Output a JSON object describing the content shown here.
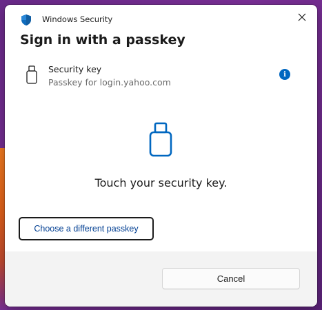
{
  "window": {
    "app_title": "Windows Security",
    "heading": "Sign in with a passkey"
  },
  "credential": {
    "type_label": "Security key",
    "description": "Passkey for login.yahoo.com",
    "info_glyph": "i"
  },
  "prompt": {
    "instruction": "Touch your security key."
  },
  "actions": {
    "different_passkey_label": "Choose a different passkey",
    "cancel_label": "Cancel"
  },
  "icons": {
    "app": "shield-icon",
    "close": "close-icon",
    "credential": "usb-security-key-icon",
    "info": "info-icon",
    "prompt": "usb-security-key-icon"
  },
  "colors": {
    "accent": "#0067c0",
    "link_text": "#003e92",
    "footer_bg": "#f3f3f3"
  }
}
